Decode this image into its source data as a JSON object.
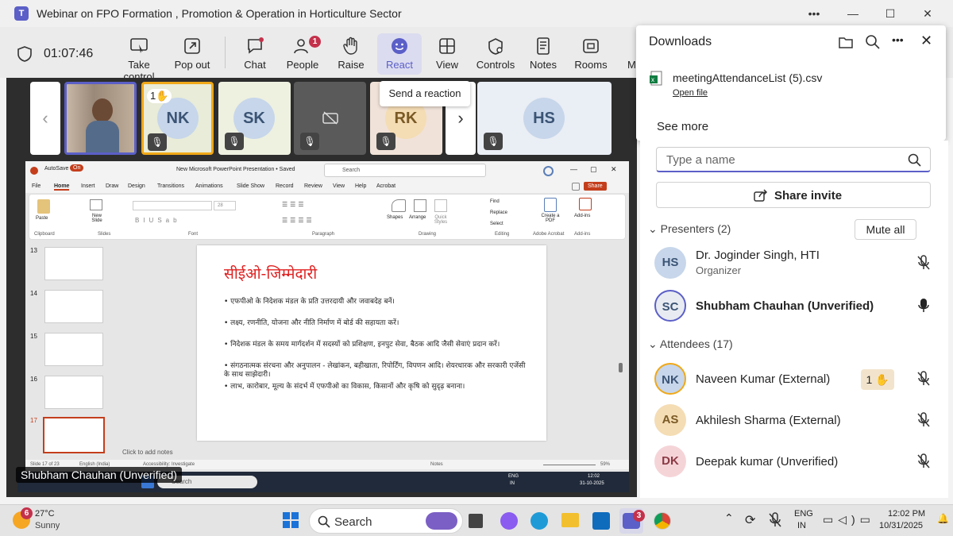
{
  "window": {
    "title": "Webinar on FPO Formation , Promotion & Operation in Horticulture Sector",
    "logo": "T"
  },
  "toolbar": {
    "timer": "01:07:46",
    "items": [
      {
        "label": "Take control",
        "icon": "take-control-icon"
      },
      {
        "label": "Pop out",
        "icon": "pop-out-icon"
      },
      {
        "label": "Chat",
        "icon": "chat-icon"
      },
      {
        "label": "People",
        "icon": "people-icon",
        "badge": "1"
      },
      {
        "label": "Raise",
        "icon": "raise-hand-icon"
      },
      {
        "label": "React",
        "icon": "react-icon"
      },
      {
        "label": "View",
        "icon": "view-icon"
      },
      {
        "label": "Controls",
        "icon": "controls-icon"
      },
      {
        "label": "Notes",
        "icon": "notes-icon"
      },
      {
        "label": "Rooms",
        "icon": "rooms-icon"
      },
      {
        "label": "M",
        "icon": "more-icon"
      }
    ],
    "tooltip": "Send a reaction"
  },
  "gallery": {
    "tiles": [
      {
        "initials": "",
        "kind": "video"
      },
      {
        "initials": "NK",
        "hand": "1"
      },
      {
        "initials": "SK"
      },
      {
        "initials": "",
        "kind": "camera-off"
      },
      {
        "initials": "RK"
      },
      {
        "initials": "HS"
      }
    ]
  },
  "share": {
    "presenter_label": "Shubham Chauhan (Unverified)",
    "ppt": {
      "autosave": "AutoSave",
      "on": "On",
      "filename": "New Microsoft PowerPoint Presentation • Saved",
      "search": "Search",
      "share": "Share",
      "menu": [
        "File",
        "Home",
        "Insert",
        "Draw",
        "Design",
        "Transitions",
        "Animations",
        "Slide Show",
        "Record",
        "Review",
        "View",
        "Help",
        "Acrobat"
      ],
      "groups": [
        "Clipboard",
        "Slides",
        "Font",
        "Paragraph",
        "Drawing",
        "Editing",
        "Adobe Acrobat",
        "Add-ins"
      ],
      "ribbon": {
        "paste": "Paste",
        "new_slide": "New Slide",
        "font_size": "28",
        "shapes": "Shapes",
        "arrange": "Arrange",
        "quick_styles": "Quick Styles",
        "find": "Find",
        "replace": "Replace",
        "select": "Select",
        "create_pdf": "Create a PDF",
        "add_ins": "Add-ins"
      },
      "thumb_numbers": [
        "13",
        "14",
        "15",
        "16",
        "17"
      ],
      "slide_title": "सीईओ-जिम्मेदारी",
      "bullets": [
        "एफपीओ के निदेशक मंडल के प्रति उत्तरदायी और जवाबदेह बनें।",
        "लक्ष्य, रणनीति, योजना और नीति निर्माण में बोर्ड की सहायता करें।",
        "निदेशक मंडल के समय मार्गदर्शन में सदस्यों को प्रशिक्षण, इनपुट सेवा, बैठक आदि जैसी सेवाएं प्रदान करें।",
        "संगठनात्मक संरचना और अनुपालन - लेखांकन, बहीखाता, रिपोर्टिंग, विपणन आदि। शेयरधारक और सरकारी एजेंसी के साथ साझेदारी।",
        "लाभ, कारोबार, मूल्य के संदर्भ में एफपीओ का विकास, किसानों और कृषि को सुदृढ़ बनाना।"
      ],
      "notes": "Click to add notes",
      "status": "Slide 17 of 23",
      "language": "English (India)",
      "accessibility": "Accessibility: Investigate",
      "notes_btn": "Notes",
      "zoom": "59%"
    },
    "inner_taskbar": {
      "search": "Search",
      "lang": "ENG",
      "lang2": "IN",
      "time": "12:02",
      "date": "31-10-2025"
    }
  },
  "downloads": {
    "title": "Downloads",
    "file": "meetingAttendanceList (5).csv",
    "open": "Open file",
    "see_more": "See more"
  },
  "people": {
    "search_placeholder": "Type a name",
    "share_invite": "Share invite",
    "presenters_header": "Presenters (2)",
    "mute_all": "Mute all",
    "attendees_header": "Attendees (17)",
    "presenters": [
      {
        "initials": "HS",
        "name": "Dr. Joginder Singh, HTI",
        "role": "Organizer"
      },
      {
        "initials": "SC",
        "name": "Shubham Chauhan (Unverified)"
      }
    ],
    "attendees": [
      {
        "initials": "NK",
        "name": "Naveen Kumar (External)",
        "hand": "1"
      },
      {
        "initials": "AS",
        "name": "Akhilesh Sharma (External)"
      },
      {
        "initials": "DK",
        "name": "Deepak kumar (Unverified)"
      }
    ]
  },
  "taskbar": {
    "weather_temp": "27°C",
    "weather_desc": "Sunny",
    "weather_badge": "6",
    "search": "Search",
    "teams_badge": "3",
    "lang": "ENG",
    "lang2": "IN",
    "time": "12:02 PM",
    "date": "10/31/2025"
  }
}
